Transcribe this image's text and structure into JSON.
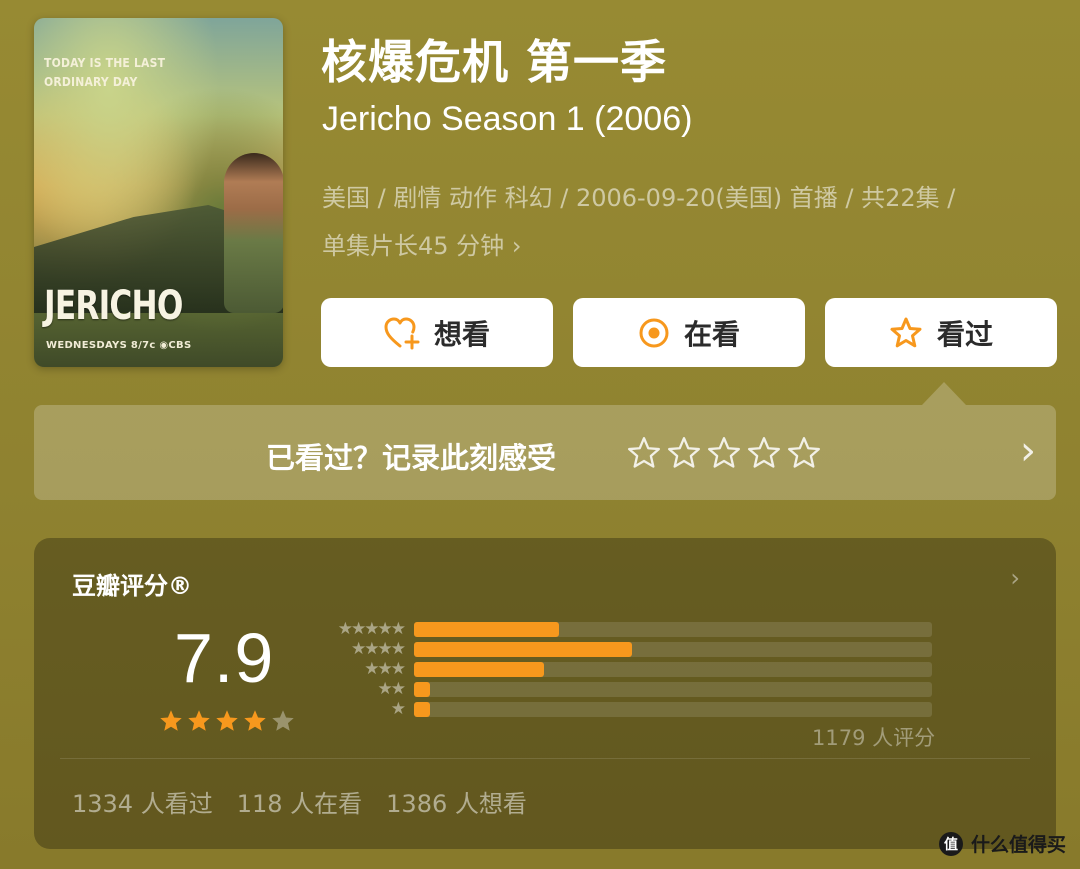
{
  "poster": {
    "tagline_line1": "TODAY IS THE LAST",
    "tagline_line2": "ORDINARY DAY",
    "show_logo": "JERICHO",
    "airtime": "WEDNESDAYS 8/7c",
    "network": "CBS"
  },
  "header": {
    "title_cn": "核爆危机 第一季",
    "title_en": "Jericho Season 1 (2006)",
    "meta_line1": "美国 / 剧情 动作 科幻 / 2006-09-20(美国) 首播 / 共22集 /",
    "meta_line2": "单集片长45 分钟",
    "meta_chevron": "›"
  },
  "actions": {
    "want_label": "想看",
    "watching_label": "在看",
    "watched_label": "看过"
  },
  "rate_prompt": {
    "text": "已看过？记录此刻感受",
    "chevron": "›"
  },
  "score": {
    "title": "豆瓣评分®",
    "chevron": "›",
    "value": "7.9",
    "stars_filled": 4,
    "stars_total": 5,
    "distribution": [
      {
        "stars": "★★★★★",
        "fraction": 0.28
      },
      {
        "stars": "★★★★",
        "fraction": 0.42
      },
      {
        "stars": "★★★",
        "fraction": 0.25
      },
      {
        "stars": "★★",
        "fraction": 0.03
      },
      {
        "stars": "★",
        "fraction": 0.03
      }
    ],
    "raters": "1179 人评分",
    "watched": "1334 人看过",
    "watching": "118 人在看",
    "want": "1386 人想看"
  },
  "watermark": {
    "logo": "值",
    "text": "什么值得买"
  },
  "colors": {
    "accent_orange": "#f7981d",
    "background": "#93862f"
  }
}
